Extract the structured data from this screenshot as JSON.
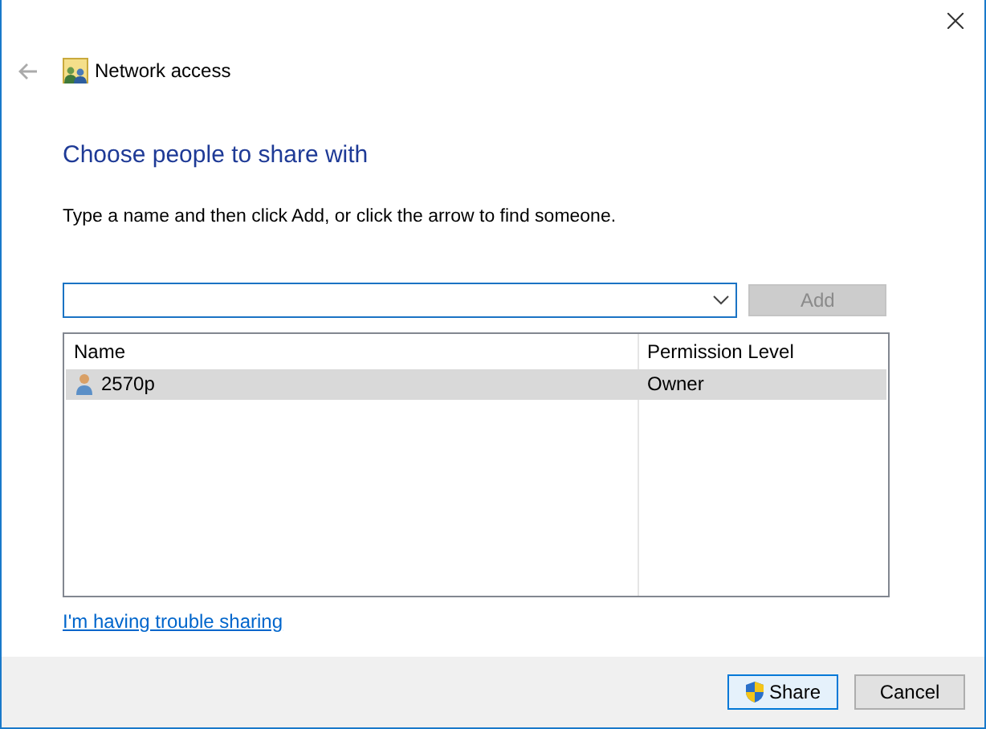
{
  "window": {
    "title": "Network access"
  },
  "heading": "Choose people to share with",
  "instruction": "Type a name and then click Add, or click the arrow to find someone.",
  "add_button": {
    "label": "Add",
    "disabled": true
  },
  "table": {
    "columns": [
      "Name",
      "Permission Level"
    ],
    "rows": [
      {
        "name": "2570p",
        "permission": "Owner",
        "selected": true
      }
    ]
  },
  "help_link": "I'm having trouble sharing",
  "buttons": [
    {
      "label": "Share",
      "kind": "shield",
      "default": true
    },
    {
      "label": "Cancel",
      "kind": "plain",
      "default": false
    }
  ]
}
